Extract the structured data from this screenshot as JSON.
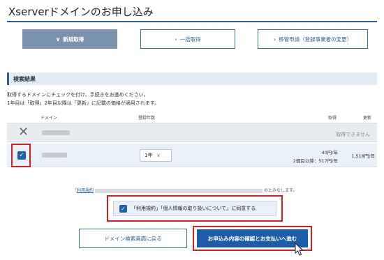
{
  "page": {
    "title": "Xserverドメインのお申し込み"
  },
  "tabs": [
    {
      "label": "新規取得",
      "chevron": "∨"
    },
    {
      "label": "一括取得",
      "chevron": "›"
    },
    {
      "label": "移管申請（登録事業者の変更）",
      "chevron": "›"
    }
  ],
  "results": {
    "header": "検索結果",
    "note1": "取得するドメインにチェックを付け、手続きをお進めください。",
    "note2": "1年目は「取得」2年目以降は「更新」に記載の価格が適用されます。",
    "columns": {
      "domain": "ドメイン",
      "years": "登録年数",
      "acquire": "取得",
      "renew": "更新"
    },
    "row_unavailable": {
      "status": "取得できません",
      "icon": "close-icon"
    },
    "row_selected": {
      "checked": true,
      "year_value": "1年",
      "price_first": "40円/年",
      "price_second": "2個目以降：517円/年",
      "price_renew": "1,518円/年"
    }
  },
  "terms": {
    "prefix": "「",
    "link": "利用規約",
    "suffix": "のとみなします。",
    "agree_label": "「利用規約」「個人情報の取り扱いについて」に同意する",
    "agree_checked": true
  },
  "actions": {
    "back_label": "ドメイン検索画面に戻る",
    "confirm_label": "お申込み内容の確認とお支払いへ進む"
  },
  "colors": {
    "brand": "#1d5da8",
    "highlight": "#d51f1f",
    "active_tab": "#7c93ad"
  }
}
